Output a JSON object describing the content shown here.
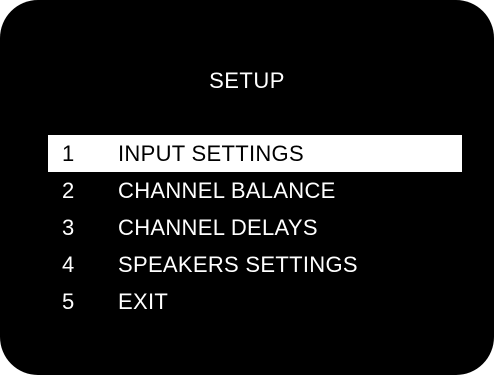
{
  "screen": {
    "title": "SETUP",
    "selected_index": 0,
    "colors": {
      "background": "#000000",
      "text": "#ffffff",
      "highlight_bg": "#ffffff",
      "highlight_text": "#000000"
    }
  },
  "menu": {
    "items": [
      {
        "number": "1",
        "label": "INPUT SETTINGS"
      },
      {
        "number": "2",
        "label": "CHANNEL BALANCE"
      },
      {
        "number": "3",
        "label": "CHANNEL DELAYS"
      },
      {
        "number": "4",
        "label": "SPEAKERS SETTINGS"
      },
      {
        "number": "5",
        "label": "EXIT"
      }
    ]
  }
}
